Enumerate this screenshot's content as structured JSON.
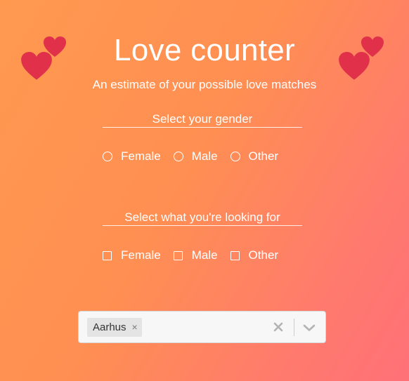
{
  "header": {
    "title": "Love counter",
    "subtitle": "An estimate of your possible love matches"
  },
  "gender_section": {
    "label": "Select your gender",
    "options": [
      "Female",
      "Male",
      "Other"
    ]
  },
  "looking_for_section": {
    "label": "Select what you're looking for",
    "options": [
      "Female",
      "Male",
      "Other"
    ]
  },
  "city_select": {
    "selected": [
      "Aarhus"
    ],
    "remove_symbol": "×"
  },
  "colors": {
    "heart": "#e0304a",
    "background_start": "#ff9950",
    "background_end": "#ff7077"
  },
  "icons": {
    "decor": "hearts-icon",
    "clear": "clear-icon",
    "dropdown": "chevron-down-icon"
  }
}
